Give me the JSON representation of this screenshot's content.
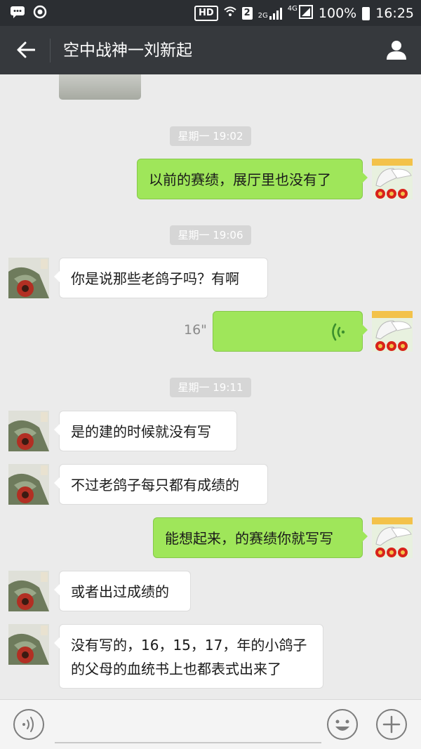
{
  "status_bar": {
    "hd": "HD",
    "sim": "2",
    "net_2g": "2G",
    "net_4g": "4G",
    "battery": "100%",
    "time": "16:25"
  },
  "header": {
    "title": "空中战神一刘新起"
  },
  "messages": [
    {
      "type": "time",
      "text": "星期一 19:02"
    },
    {
      "type": "out",
      "text": "以前的赛绩，展厅里也没有了"
    },
    {
      "type": "time",
      "text": "星期一 19:06"
    },
    {
      "type": "in",
      "text": "你是说那些老鸽子吗？有啊"
    },
    {
      "type": "voice_out",
      "duration": "16\""
    },
    {
      "type": "time",
      "text": "星期一 19:11"
    },
    {
      "type": "in",
      "text": "是的建的时候就没有写"
    },
    {
      "type": "in",
      "text": "不过老鸽子每只都有成绩的"
    },
    {
      "type": "out",
      "text": "能想起来，的赛绩你就写写"
    },
    {
      "type": "in",
      "text": "或者出过成绩的"
    },
    {
      "type": "in",
      "text": "没有写的，16，15，17，年的小鸽子的父母的血统书上也都表式出来了"
    }
  ],
  "input": {
    "placeholder": "",
    "value": ""
  },
  "icons": {
    "back": "back-arrow-icon",
    "profile": "person-icon",
    "voice_toggle": "voice-icon",
    "emoji": "emoji-icon",
    "more": "plus-icon",
    "voice_wave": "voice-wave-icon"
  },
  "colors": {
    "title_bar": "#36393d",
    "status_bar": "#2b2e32",
    "chat_bg": "#ebebeb",
    "bubble_out": "#9fe65a",
    "bubble_in": "#ffffff",
    "timestamp_bg": "#d6d6d6"
  }
}
